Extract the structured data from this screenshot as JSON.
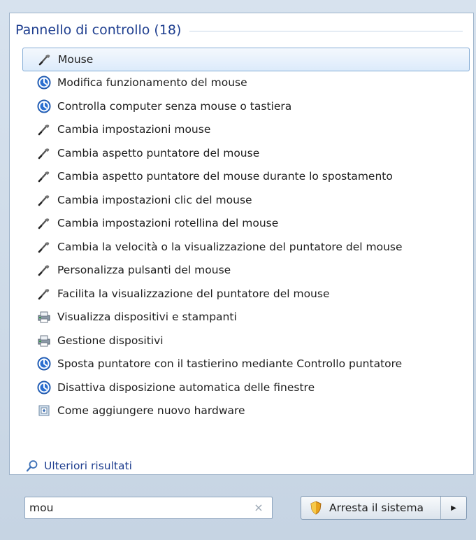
{
  "section": {
    "title": "Pannello di controllo (18)"
  },
  "results": [
    {
      "label": "Mouse",
      "icon": "mouse-icon",
      "selected": true
    },
    {
      "label": "Modifica funzionamento del mouse",
      "icon": "ease-of-access-icon"
    },
    {
      "label": "Controlla computer senza mouse o tastiera",
      "icon": "ease-of-access-icon"
    },
    {
      "label": "Cambia impostazioni mouse",
      "icon": "mouse-icon"
    },
    {
      "label": "Cambia aspetto puntatore del mouse",
      "icon": "mouse-icon"
    },
    {
      "label": "Cambia aspetto puntatore del mouse durante lo spostamento",
      "icon": "mouse-icon"
    },
    {
      "label": "Cambia impostazioni clic del mouse",
      "icon": "mouse-icon"
    },
    {
      "label": "Cambia impostazioni rotellina del mouse",
      "icon": "mouse-icon"
    },
    {
      "label": "Cambia la velocità o la visualizzazione del puntatore del mouse",
      "icon": "mouse-icon"
    },
    {
      "label": "Personalizza pulsanti del mouse",
      "icon": "mouse-icon"
    },
    {
      "label": "Facilita la visualizzazione del puntatore del mouse",
      "icon": "mouse-icon"
    },
    {
      "label": "Visualizza dispositivi e stampanti",
      "icon": "devices-printers-icon"
    },
    {
      "label": "Gestione dispositivi",
      "icon": "devices-printers-icon"
    },
    {
      "label": "Sposta puntatore con il tastierino mediante Controllo puntatore",
      "icon": "ease-of-access-icon"
    },
    {
      "label": "Disattiva disposizione automatica delle finestre",
      "icon": "ease-of-access-icon"
    },
    {
      "label": "Come aggiungere nuovo hardware",
      "icon": "add-hardware-icon"
    }
  ],
  "more_results": {
    "label": "Ulteriori risultati",
    "icon": "search-icon"
  },
  "search": {
    "value": "mou",
    "clear_glyph": "×"
  },
  "shutdown": {
    "label": "Arresta il sistema",
    "icon": "shield-icon",
    "arrow_glyph": "▶"
  },
  "colors": {
    "accent": "#1e3e8f",
    "selection_border": "#84acd6",
    "ease_blue": "#2b6fd0"
  }
}
